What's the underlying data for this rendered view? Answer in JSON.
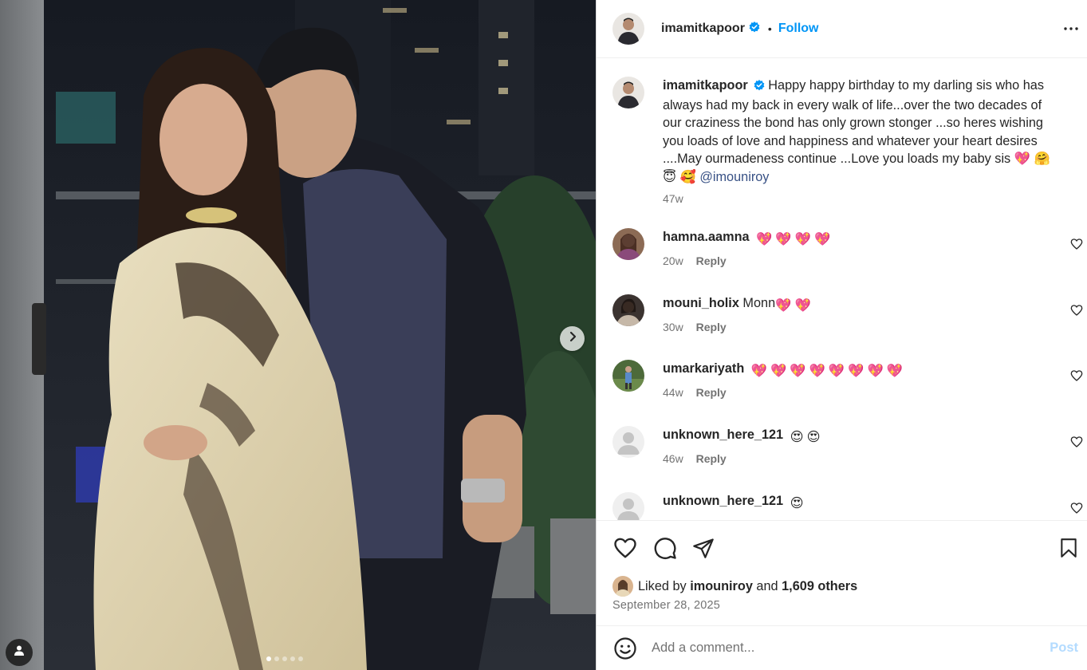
{
  "post": {
    "author": "imamitkapoor",
    "follow_label": "Follow",
    "separator": "•",
    "caption": {
      "text": "Happy happy birthday to my darling sis who has always had my back in every walk of life...over the two decades of our craziness the bond has only grown stonger ...so heres wishing you loads of love and happiness and whatever your heart desires ....May ourmadeness continue ...Love you loads my baby sis",
      "emojis": [
        "💖",
        "🤗",
        "😇",
        "🥰"
      ],
      "mention": "@imouniroy",
      "time": "47w"
    },
    "comments": [
      {
        "username": "hamna.aamna",
        "text": "",
        "emojis": [
          "💖",
          "💖",
          "💖",
          "💖"
        ],
        "time": "20w",
        "reply_label": "Reply"
      },
      {
        "username": "mouni_holix",
        "text": "Monn",
        "emojis": [
          "💖",
          "💖"
        ],
        "time": "30w",
        "reply_label": "Reply"
      },
      {
        "username": "umarkariyath",
        "text": "",
        "emojis": [
          "💖",
          "💖",
          "💖",
          "💖",
          "💖",
          "💖",
          "💖",
          "💖"
        ],
        "time": "44w",
        "reply_label": "Reply"
      },
      {
        "username": "unknown_here_121",
        "text": "",
        "emojis": [
          "😍",
          "😍"
        ],
        "time": "46w",
        "reply_label": "Reply"
      },
      {
        "username": "unknown_here_121",
        "text": "",
        "emojis": [
          "😍"
        ],
        "time": "",
        "reply_label": ""
      }
    ],
    "likes": {
      "prefix": "Liked by",
      "user": "imouniroy",
      "joiner": "and",
      "others": "1,609 others"
    },
    "date": "September 28, 2025",
    "add_comment": {
      "placeholder": "Add a comment...",
      "post_label": "Post"
    }
  },
  "carousel": {
    "total": 5,
    "active": 1
  },
  "icons": {
    "verified": "verified-badge-icon",
    "more": "more-options-icon",
    "like": "heart-icon",
    "comment": "comment-icon",
    "share": "paper-plane-icon",
    "save": "bookmark-icon",
    "emoji": "smiley-icon",
    "next": "chevron-right-icon",
    "tagged": "person-icon"
  },
  "colors": {
    "follow": "#0095f6",
    "verified": "#0095f6",
    "mention": "#385185",
    "post_button_disabled": "#b3dbff",
    "secondary_text": "#737373"
  }
}
